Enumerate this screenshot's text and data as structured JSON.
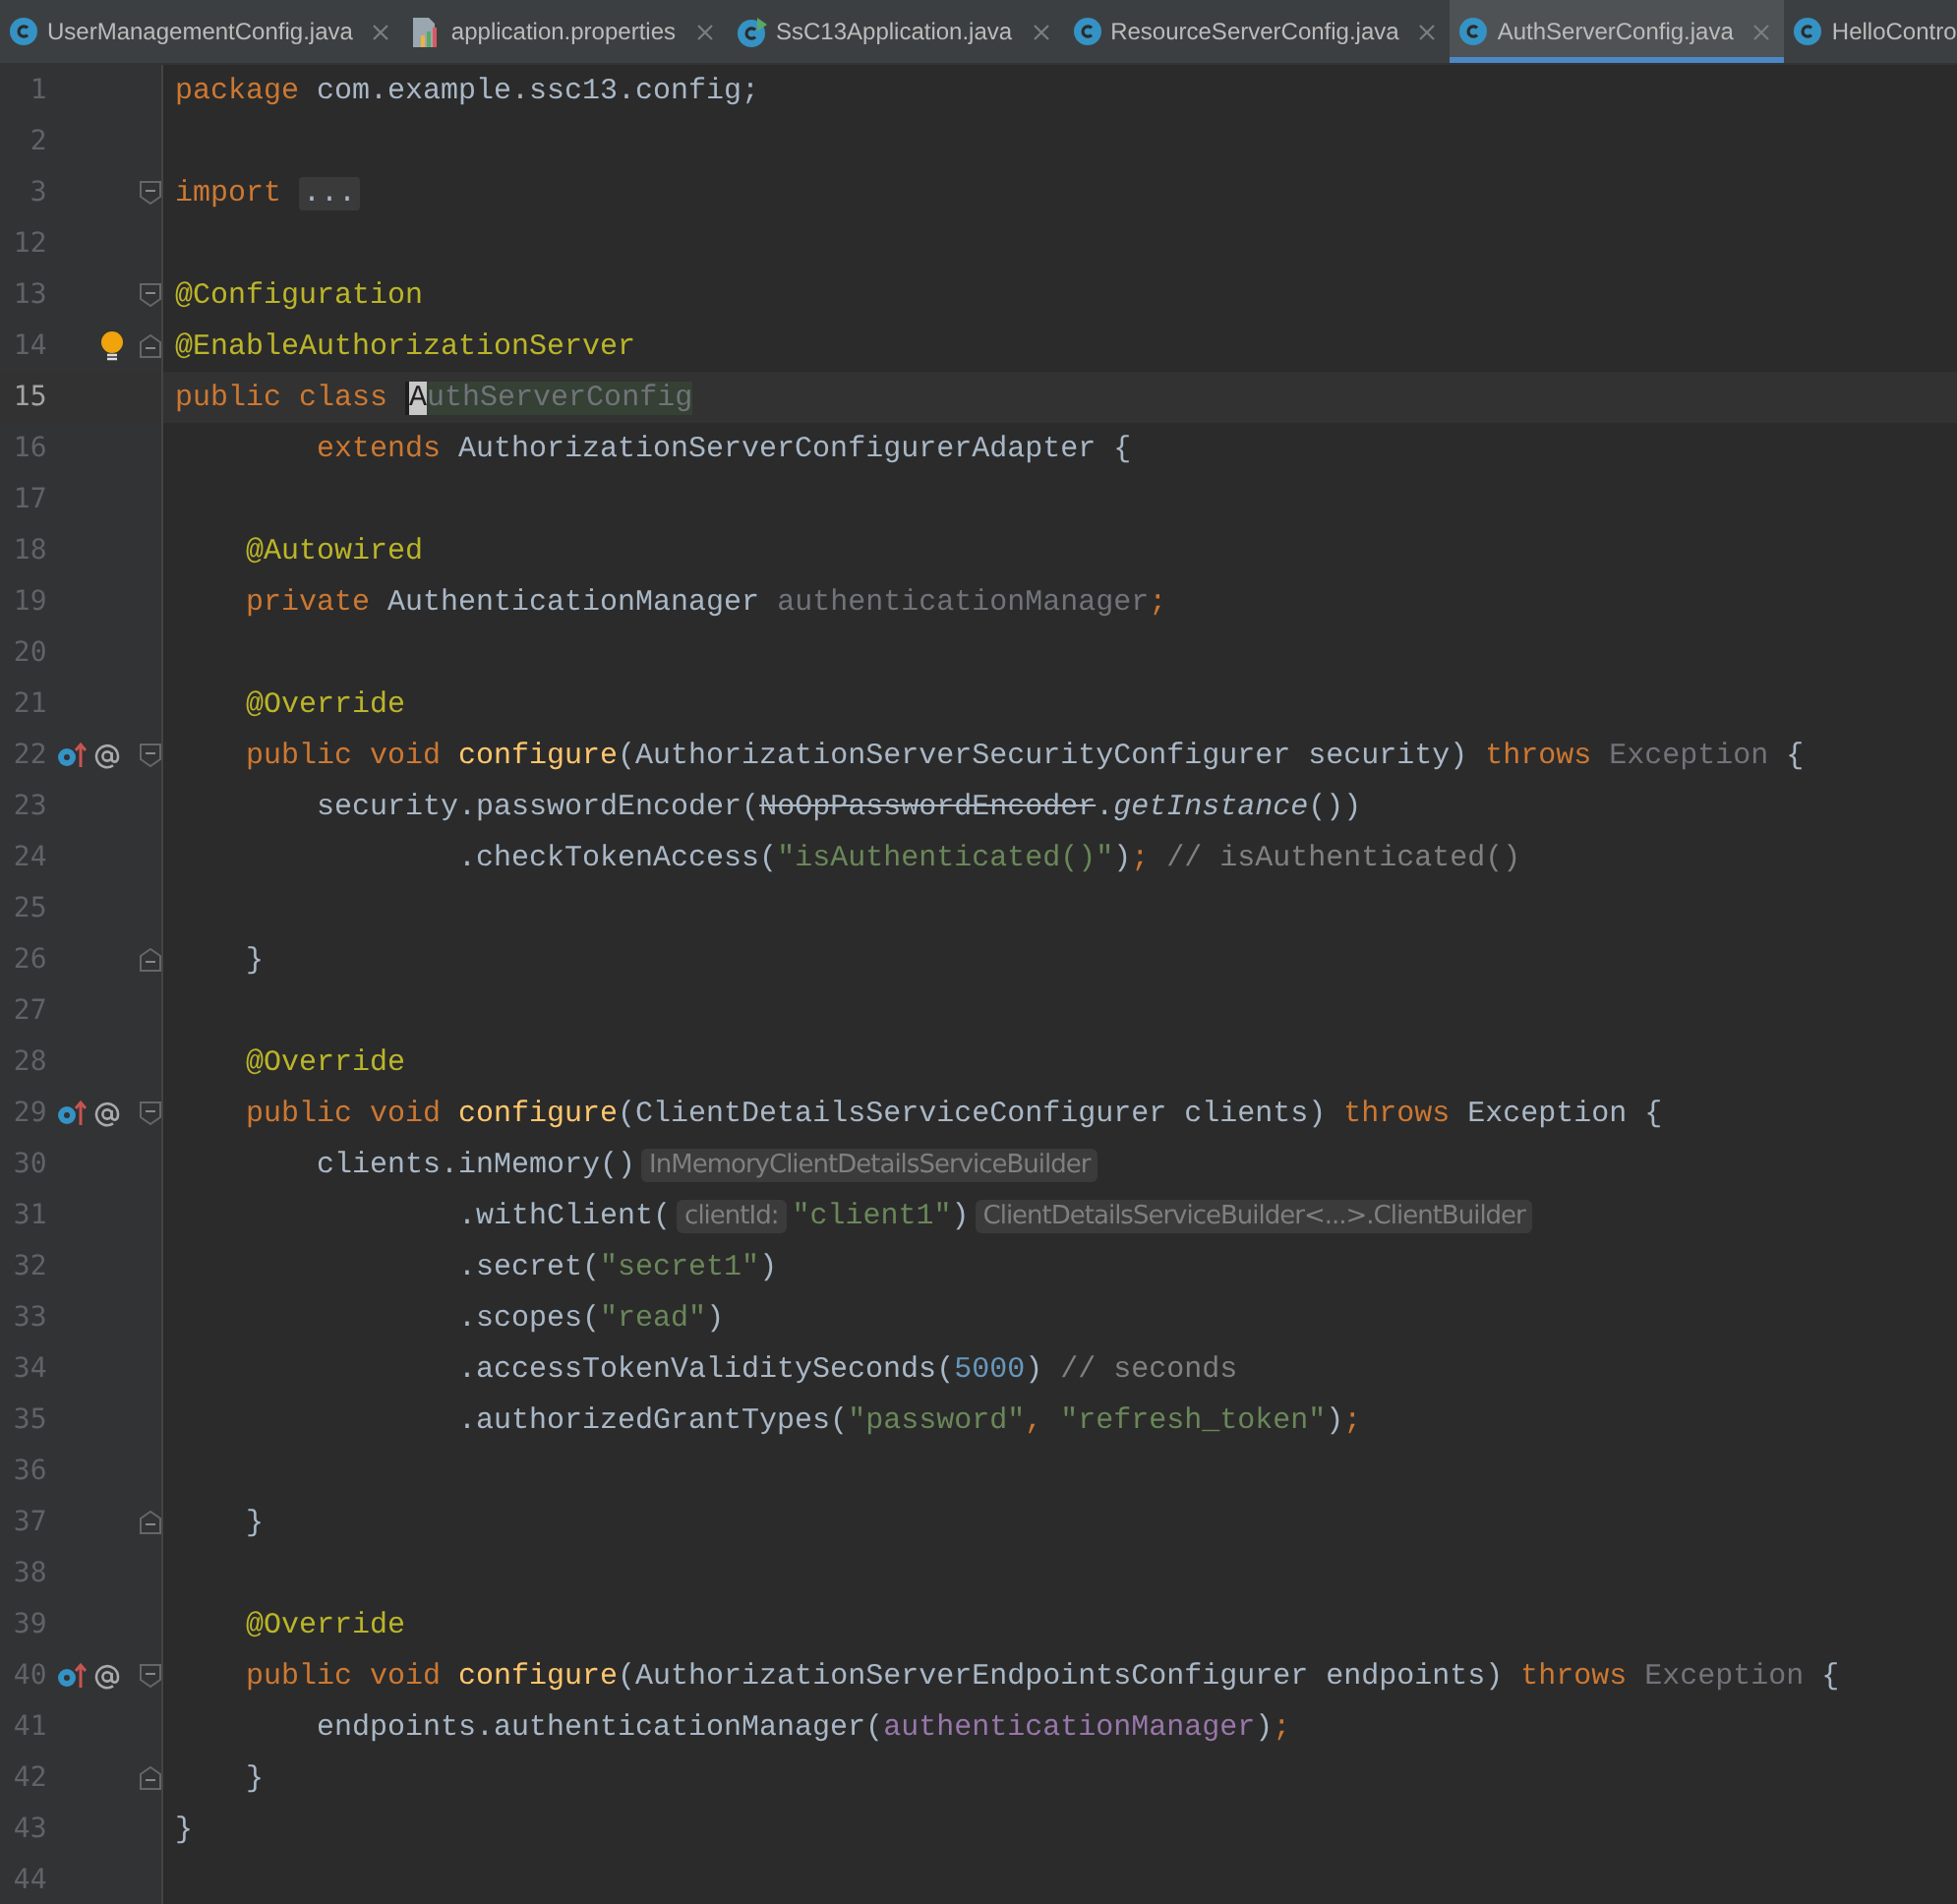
{
  "tabs": [
    {
      "label": "UserManagementConfig.java",
      "kind": "class",
      "selected": false,
      "closable": true
    },
    {
      "label": "application.properties",
      "kind": "properties",
      "selected": false,
      "closable": true
    },
    {
      "label": "SsC13Application.java",
      "kind": "app",
      "selected": false,
      "closable": true
    },
    {
      "label": "ResourceServerConfig.java",
      "kind": "class",
      "selected": false,
      "closable": true
    },
    {
      "label": "AuthServerConfig.java",
      "kind": "class",
      "selected": true,
      "closable": true
    },
    {
      "label": "HelloContro",
      "kind": "class",
      "selected": false,
      "closable": false
    }
  ],
  "lines": [
    {
      "number": "1",
      "tokens": [
        {
          "kind": "kw",
          "t": "package "
        },
        {
          "kind": "plain",
          "t": "com.example.ssc13.config;"
        }
      ]
    },
    {
      "number": "2"
    },
    {
      "number": "3",
      "fold_start": true,
      "tokens": [
        {
          "kind": "kw",
          "t": "import "
        },
        {
          "kind": "folded",
          "t": "..."
        }
      ]
    },
    {
      "number": "12"
    },
    {
      "number": "13",
      "fold_start": true,
      "tokens": [
        {
          "kind": "ann",
          "t": "@Configuration"
        }
      ]
    },
    {
      "number": "14",
      "fold_end": true,
      "bulb": true,
      "tokens": [
        {
          "kind": "ann",
          "t": "@EnableAuthorizationServer"
        }
      ]
    },
    {
      "number": "15",
      "current": true,
      "tokens": [
        {
          "kind": "kw",
          "t": "public class "
        },
        {
          "kind": "caret",
          "t": "A"
        },
        {
          "kind": "unusedhl",
          "t": "uthServerConfig"
        }
      ]
    },
    {
      "number": "16",
      "tokens": [
        {
          "kind": "kw",
          "t": "        extends "
        },
        {
          "kind": "plain",
          "t": "AuthorizationServerConfigurerAdapter {"
        }
      ]
    },
    {
      "number": "17"
    },
    {
      "number": "18",
      "tokens": [
        {
          "kind": "ann",
          "t": "    @Autowired"
        }
      ]
    },
    {
      "number": "19",
      "tokens": [
        {
          "kind": "kw",
          "t": "    private "
        },
        {
          "kind": "plain",
          "t": "AuthenticationManager "
        },
        {
          "kind": "unused",
          "t": "authenticationManager"
        },
        {
          "kind": "kw",
          "t": ";"
        }
      ]
    },
    {
      "number": "20"
    },
    {
      "number": "21",
      "tokens": [
        {
          "kind": "ann",
          "t": "    @Override"
        }
      ]
    },
    {
      "number": "22",
      "override": true,
      "fold_start": true,
      "tokens": [
        {
          "kind": "kw",
          "t": "    public void "
        },
        {
          "kind": "fn",
          "t": "configure"
        },
        {
          "kind": "plain",
          "t": "(AuthorizationServerSecurityConfigurer security) "
        },
        {
          "kind": "kw",
          "t": "throws "
        },
        {
          "kind": "unused",
          "t": "Exception "
        },
        {
          "kind": "plain",
          "t": "{"
        }
      ]
    },
    {
      "number": "23",
      "tokens": [
        {
          "kind": "plain",
          "t": "        security.passwordEncoder("
        },
        {
          "kind": "strike",
          "t": "NoOpPasswordEncoder"
        },
        {
          "kind": "plain",
          "t": "."
        },
        {
          "kind": "italic",
          "t": "getInstance"
        },
        {
          "kind": "plain",
          "t": "())"
        }
      ]
    },
    {
      "number": "24",
      "tokens": [
        {
          "kind": "plain",
          "t": "                .checkTokenAccess("
        },
        {
          "kind": "str",
          "t": "\"isAuthenticated()\""
        },
        {
          "kind": "plain",
          "t": ")"
        },
        {
          "kind": "kw",
          "t": ";"
        },
        {
          "kind": "comment",
          "t": " // isAuthenticated()"
        }
      ]
    },
    {
      "number": "25"
    },
    {
      "number": "26",
      "fold_end": true,
      "tokens": [
        {
          "kind": "plain",
          "t": "    }"
        }
      ]
    },
    {
      "number": "27"
    },
    {
      "number": "28",
      "tokens": [
        {
          "kind": "ann",
          "t": "    @Override"
        }
      ]
    },
    {
      "number": "29",
      "override": true,
      "fold_start": true,
      "tokens": [
        {
          "kind": "kw",
          "t": "    public void "
        },
        {
          "kind": "fn",
          "t": "configure"
        },
        {
          "kind": "plain",
          "t": "(ClientDetailsServiceConfigurer clients) "
        },
        {
          "kind": "kw",
          "t": "throws "
        },
        {
          "kind": "plain",
          "t": "Exception {"
        }
      ]
    },
    {
      "number": "30",
      "tokens": [
        {
          "kind": "plain",
          "t": "        clients.inMemory()"
        },
        {
          "kind": "hint",
          "t": "InMemoryClientDetailsServiceBuilder"
        }
      ]
    },
    {
      "number": "31",
      "tokens": [
        {
          "kind": "plain",
          "t": "                .withClient("
        },
        {
          "kind": "hint",
          "t": "clientId:"
        },
        {
          "kind": "str",
          "t": "\"client1\""
        },
        {
          "kind": "plain",
          "t": ")"
        },
        {
          "kind": "hint",
          "t": "ClientDetailsServiceBuilder<...>.ClientBuilder"
        }
      ]
    },
    {
      "number": "32",
      "tokens": [
        {
          "kind": "plain",
          "t": "                .secret("
        },
        {
          "kind": "str",
          "t": "\"secret1\""
        },
        {
          "kind": "plain",
          "t": ")"
        }
      ]
    },
    {
      "number": "33",
      "tokens": [
        {
          "kind": "plain",
          "t": "                .scopes("
        },
        {
          "kind": "str",
          "t": "\"read\""
        },
        {
          "kind": "plain",
          "t": ")"
        }
      ]
    },
    {
      "number": "34",
      "tokens": [
        {
          "kind": "plain",
          "t": "                .accessTokenValiditySeconds("
        },
        {
          "kind": "num",
          "t": "5000"
        },
        {
          "kind": "plain",
          "t": ")"
        },
        {
          "kind": "comment",
          "t": " // seconds"
        }
      ]
    },
    {
      "number": "35",
      "tokens": [
        {
          "kind": "plain",
          "t": "                .authorizedGrantTypes("
        },
        {
          "kind": "str",
          "t": "\"password\""
        },
        {
          "kind": "kw",
          "t": ", "
        },
        {
          "kind": "str",
          "t": "\"refresh_token\""
        },
        {
          "kind": "plain",
          "t": ")"
        },
        {
          "kind": "kw",
          "t": ";"
        }
      ]
    },
    {
      "number": "36"
    },
    {
      "number": "37",
      "fold_end": true,
      "tokens": [
        {
          "kind": "plain",
          "t": "    }"
        }
      ]
    },
    {
      "number": "38"
    },
    {
      "number": "39",
      "tokens": [
        {
          "kind": "ann",
          "t": "    @Override"
        }
      ]
    },
    {
      "number": "40",
      "override": true,
      "fold_start": true,
      "tokens": [
        {
          "kind": "kw",
          "t": "    public void "
        },
        {
          "kind": "fn",
          "t": "configure"
        },
        {
          "kind": "plain",
          "t": "(AuthorizationServerEndpointsConfigurer endpoints) "
        },
        {
          "kind": "kw",
          "t": "throws "
        },
        {
          "kind": "unused",
          "t": "Exception "
        },
        {
          "kind": "plain",
          "t": "{"
        }
      ]
    },
    {
      "number": "41",
      "tokens": [
        {
          "kind": "plain",
          "t": "        endpoints.authenticationManager("
        },
        {
          "kind": "field",
          "t": "authenticationManager"
        },
        {
          "kind": "plain",
          "t": ")"
        },
        {
          "kind": "kw",
          "t": ";"
        }
      ]
    },
    {
      "number": "42",
      "fold_end": true,
      "tokens": [
        {
          "kind": "plain",
          "t": "    }"
        }
      ]
    },
    {
      "number": "43",
      "tokens": [
        {
          "kind": "plain",
          "t": "}"
        }
      ]
    },
    {
      "number": "44"
    }
  ]
}
